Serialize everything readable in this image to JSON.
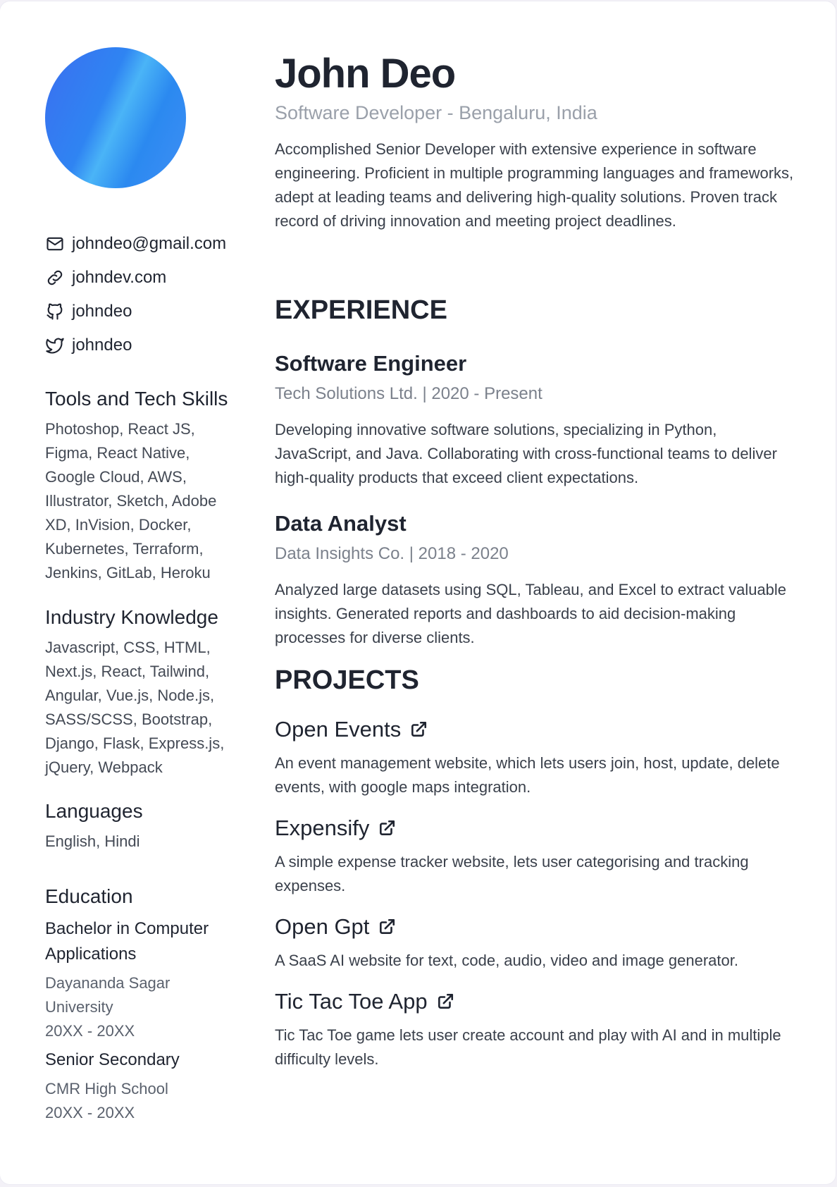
{
  "profile": {
    "name": "John Deo",
    "role": "Software Developer - Bengaluru, India",
    "summary": "Accomplished Senior Developer with extensive experience in software engineering. Proficient in multiple programming languages and frameworks, adept at leading teams and delivering high-quality solutions. Proven track record of driving innovation and meeting project deadlines."
  },
  "contacts": {
    "email": "johndeo@gmail.com",
    "website": "johndev.com",
    "github": "johndeo",
    "twitter": "johndeo"
  },
  "skills": {
    "heading": "Tools and Tech Skills",
    "text": "Photoshop, React JS, Figma, React Native, Google Cloud, AWS, Illustrator, Sketch, Adobe XD, InVision, Docker, Kubernetes, Terraform, Jenkins, GitLab, Heroku"
  },
  "industry": {
    "heading": "Industry Knowledge",
    "text": "Javascript, CSS, HTML, Next.js, React, Tailwind, Angular, Vue.js, Node.js, SASS/SCSS, Bootstrap, Django, Flask, Express.js, jQuery, Webpack"
  },
  "languages": {
    "heading": "Languages",
    "text": "English, Hindi"
  },
  "education": {
    "heading": "Education",
    "items": [
      {
        "degree": "Bachelor in Computer Applications",
        "school": "Dayananda Sagar University",
        "years": "20XX - 20XX"
      },
      {
        "degree": "Senior Secondary",
        "school": "CMR High School",
        "years": "20XX - 20XX"
      }
    ]
  },
  "experience": {
    "heading": "EXPERIENCE",
    "items": [
      {
        "title": "Software Engineer",
        "meta": "Tech Solutions Ltd. | 2020 - Present",
        "description": "Developing innovative software solutions, specializing in Python, JavaScript, and Java. Collaborating with cross-functional teams to deliver high-quality products that exceed client expectations."
      },
      {
        "title": "Data Analyst",
        "meta": "Data Insights Co. | 2018 - 2020",
        "description": "Analyzed large datasets using SQL, Tableau, and Excel to extract valuable insights. Generated reports and dashboards to aid decision-making processes for diverse clients."
      }
    ]
  },
  "projects": {
    "heading": "PROJECTS",
    "items": [
      {
        "title": "Open Events",
        "description": "An event management website, which lets users join, host, update, delete events, with google maps integration."
      },
      {
        "title": "Expensify",
        "description": "A simple expense tracker website, lets user categorising and tracking expenses."
      },
      {
        "title": "Open Gpt",
        "description": "A SaaS AI website for text, code, audio, video and image generator."
      },
      {
        "title": "Tic Tac Toe App",
        "description": "Tic Tac Toe game lets user create account and play with AI and in multiple difficulty levels."
      }
    ]
  },
  "icons": {
    "email": "mail-icon",
    "website": "link-icon",
    "github": "github-icon",
    "twitter": "twitter-icon",
    "project_link": "external-link-icon"
  },
  "colors": {
    "avatar_gradient_start": "#3b6ff0",
    "avatar_gradient_end": "#4ab4f7",
    "muted_text": "#9aa0aa"
  }
}
